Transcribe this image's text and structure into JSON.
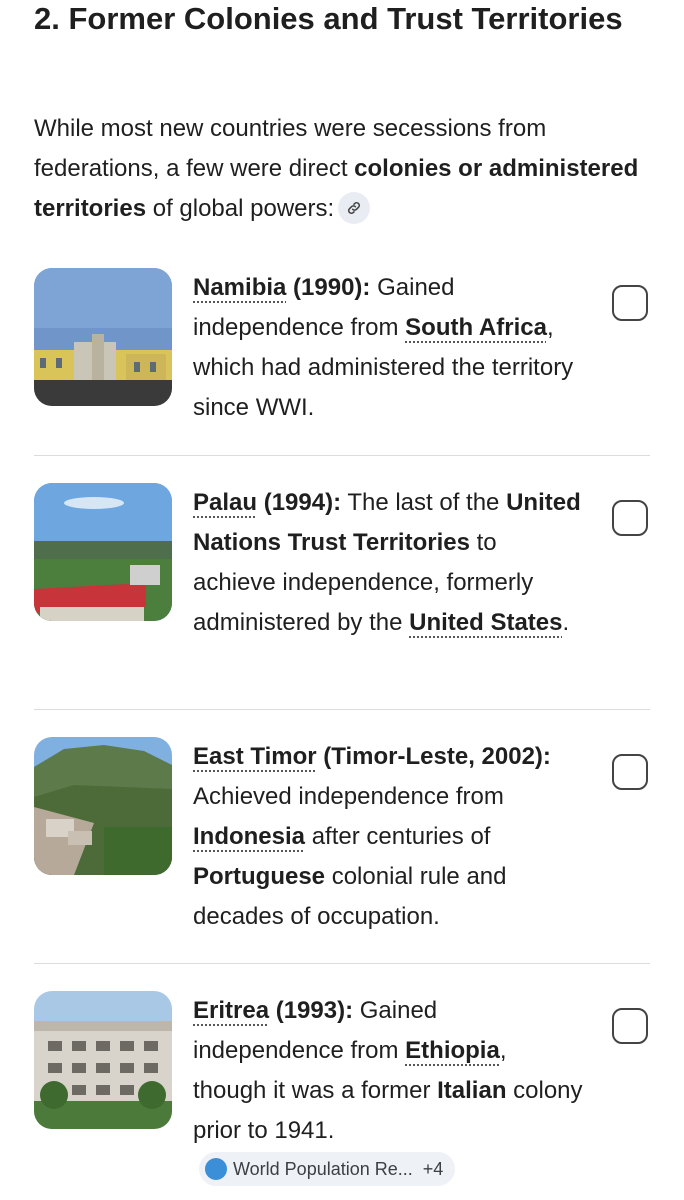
{
  "section": {
    "title": "2. Former Colonies and Trust Territories",
    "intro_part1": "While most new countries were secessions from federations, a few were direct ",
    "intro_bold": "colonies or administered territories",
    "intro_part2": " of global powers:",
    "link_icon": "link-icon"
  },
  "items": [
    {
      "name": "Namibia",
      "bold_rest": " (1990):",
      "t1": " Gained independence from ",
      "e1": "South Africa",
      "t2": ", which had administered the territory since WWI."
    },
    {
      "name": "Palau",
      "bold_rest": " (1994):",
      "t1": " The last of the ",
      "b1": "United Nations Trust Territories",
      "t2": " to achieve independence, formerly administered by the ",
      "e1": "United States",
      "t3": "."
    },
    {
      "name": "East Timor",
      "bold_rest": " (Timor-Leste, 2002):",
      "t1": " Achieved independence from ",
      "e1": "Indonesia",
      "t2": " after centuries of ",
      "b1": "Portuguese",
      "t3": " colonial rule and decades of occupation."
    },
    {
      "name": "Eritrea",
      "bold_rest": " (1993):",
      "t1": " Gained independence from ",
      "e1": "Ethiopia",
      "t2": ", though it was a former ",
      "b1": "Italian",
      "t3": " colony prior to 1941.",
      "source_label": "World Population Re...",
      "source_more": "+4"
    }
  ],
  "colors": {
    "text": "#1f1f1f",
    "divider": "#dcdcdc",
    "chip_bg": "#eef1f6"
  }
}
